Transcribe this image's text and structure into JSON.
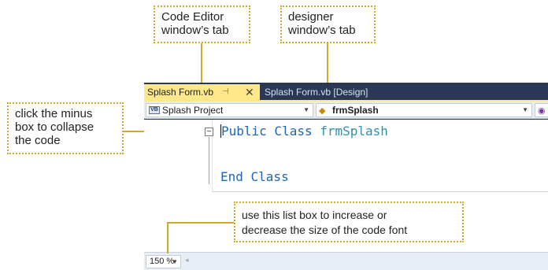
{
  "callouts": {
    "code_editor_tab": {
      "line1": "Code Editor",
      "line2": "window’s tab"
    },
    "designer_tab": {
      "line1": "designer",
      "line2": "window’s tab"
    },
    "minus_box": {
      "line1": "click the minus",
      "line2": "box to collapse",
      "line3": "the code"
    },
    "zoom_list": {
      "line1": "use this list box to increase or",
      "line2": "decrease the size of the code font"
    }
  },
  "tabs": {
    "active": {
      "label": "Splash Form.vb",
      "pin_icon": "pin-icon",
      "close_icon": "close-icon"
    },
    "inactive": {
      "label": "Splash Form.vb [Design]"
    }
  },
  "navbar": {
    "project_combo": {
      "badge": "VB",
      "value": "Splash Project"
    },
    "class_combo": {
      "value": "frmSplash"
    },
    "member_combo": {
      "icon": "method-icon"
    }
  },
  "code": {
    "line1": {
      "keyword": "Public Class",
      "name": "frmSplash"
    },
    "line2": {
      "keyword": "End Class"
    }
  },
  "status": {
    "zoom": "150 %"
  },
  "colors": {
    "callout_border": "#d4a82a",
    "active_tab": "#ffe88a",
    "ide_frame": "#293955",
    "keyword": "#1b64b8",
    "class_name": "#2b91af"
  }
}
